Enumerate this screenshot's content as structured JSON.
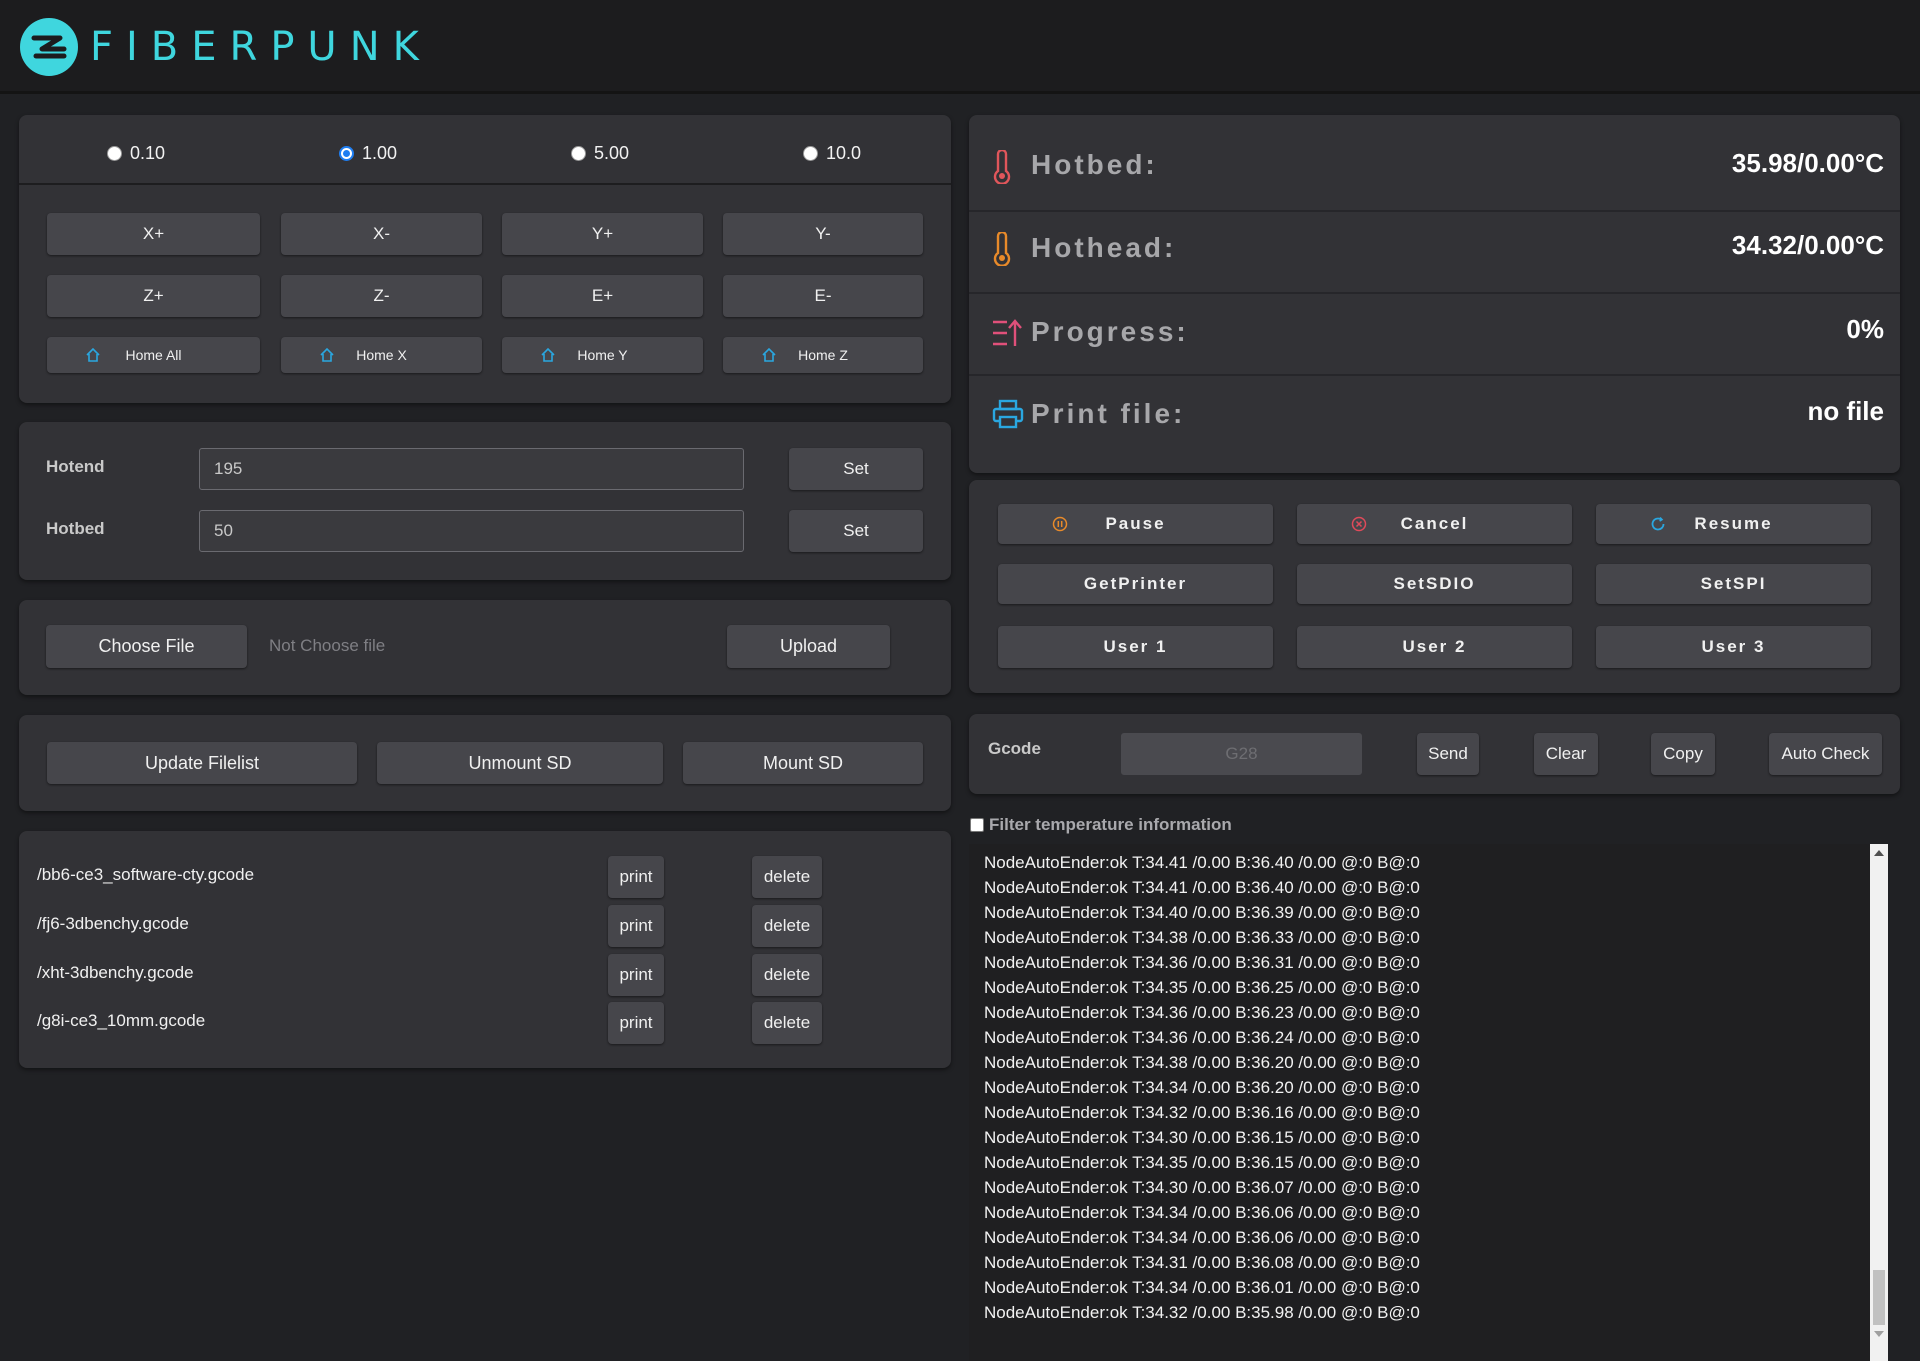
{
  "header": {
    "brand": "FIBERPUNK"
  },
  "step": {
    "options": [
      {
        "label": "0.10",
        "selected": false
      },
      {
        "label": "1.00",
        "selected": true
      },
      {
        "label": "5.00",
        "selected": false
      },
      {
        "label": "10.0",
        "selected": false
      }
    ],
    "moves": [
      "X+",
      "X-",
      "Y+",
      "Y-",
      "Z+",
      "Z-",
      "E+",
      "E-"
    ],
    "homes": [
      "Home All",
      "Home X",
      "Home Y",
      "Home Z"
    ]
  },
  "temps": {
    "hotend_label": "Hotend",
    "hotend_value": "195",
    "hotbed_label": "Hotbed",
    "hotbed_value": "50",
    "set_label": "Set"
  },
  "upload": {
    "choose_label": "Choose File",
    "status": "Not Choose file",
    "upload_label": "Upload"
  },
  "sd": {
    "update_label": "Update Filelist",
    "unmount_label": "Unmount SD",
    "mount_label": "Mount SD"
  },
  "files": {
    "print_label": "print",
    "delete_label": "delete",
    "items": [
      "/bb6-ce3_software-cty.gcode",
      "/fj6-3dbenchy.gcode",
      "/xht-3dbenchy.gcode",
      "/g8i-ce3_10mm.gcode"
    ]
  },
  "status": {
    "hotbed_label": "Hotbed:",
    "hotbed_value": "35.98/0.00°C",
    "hothead_label": "Hothead:",
    "hothead_value": "34.32/0.00°C",
    "progress_label": "Progress:",
    "progress_value": "0%",
    "file_label": "Print file:",
    "file_value": "no file"
  },
  "actions": {
    "pause": "Pause",
    "cancel": "Cancel",
    "resume": "Resume",
    "getprinter": "GetPrinter",
    "setsdio": "SetSDIO",
    "setspi": "SetSPI",
    "user1": "User 1",
    "user2": "User 2",
    "user3": "User 3"
  },
  "gcode": {
    "label": "Gcode",
    "placeholder": "G28",
    "send": "Send",
    "clear": "Clear",
    "copy": "Copy",
    "auto_check": "Auto Check",
    "filter_label": "Filter temperature information"
  },
  "console": {
    "lines": [
      "NodeAutoEnder:ok T:34.41 /0.00 B:36.40 /0.00 @:0 B@:0",
      "NodeAutoEnder:ok T:34.41 /0.00 B:36.40 /0.00 @:0 B@:0",
      "NodeAutoEnder:ok T:34.40 /0.00 B:36.39 /0.00 @:0 B@:0",
      "NodeAutoEnder:ok T:34.38 /0.00 B:36.33 /0.00 @:0 B@:0",
      "NodeAutoEnder:ok T:34.36 /0.00 B:36.31 /0.00 @:0 B@:0",
      "NodeAutoEnder:ok T:34.35 /0.00 B:36.25 /0.00 @:0 B@:0",
      "NodeAutoEnder:ok T:34.36 /0.00 B:36.23 /0.00 @:0 B@:0",
      "NodeAutoEnder:ok T:34.36 /0.00 B:36.24 /0.00 @:0 B@:0",
      "NodeAutoEnder:ok T:34.38 /0.00 B:36.20 /0.00 @:0 B@:0",
      "NodeAutoEnder:ok T:34.34 /0.00 B:36.20 /0.00 @:0 B@:0",
      "NodeAutoEnder:ok T:34.32 /0.00 B:36.16 /0.00 @:0 B@:0",
      "NodeAutoEnder:ok T:34.30 /0.00 B:36.15 /0.00 @:0 B@:0",
      "NodeAutoEnder:ok T:34.35 /0.00 B:36.15 /0.00 @:0 B@:0",
      "NodeAutoEnder:ok T:34.30 /0.00 B:36.07 /0.00 @:0 B@:0",
      "NodeAutoEnder:ok T:34.34 /0.00 B:36.06 /0.00 @:0 B@:0",
      "NodeAutoEnder:ok T:34.34 /0.00 B:36.06 /0.00 @:0 B@:0",
      "NodeAutoEnder:ok T:34.31 /0.00 B:36.08 /0.00 @:0 B@:0",
      "NodeAutoEnder:ok T:34.34 /0.00 B:36.01 /0.00 @:0 B@:0",
      "NodeAutoEnder:ok T:34.32 /0.00 B:35.98 /0.00 @:0 B@:0"
    ]
  },
  "colors": {
    "brand": "#3fd6de",
    "icon_blue": "#2aa7e0",
    "hotbed_icon": "#e0565b",
    "hothead_icon": "#e88a2a",
    "progress_icon": "#e0507a",
    "cancel_icon": "#e04a5a",
    "pause_icon": "#e88a2a"
  },
  "icons": {
    "logo": "fiberpunk-logo-icon",
    "home": "home-icon",
    "hotbed": "thermometer-icon",
    "hothead": "thermometer-icon",
    "progress": "progress-icon",
    "printfile": "printer-icon",
    "pause": "pause-icon",
    "cancel": "cancel-icon",
    "resume": "refresh-icon"
  }
}
